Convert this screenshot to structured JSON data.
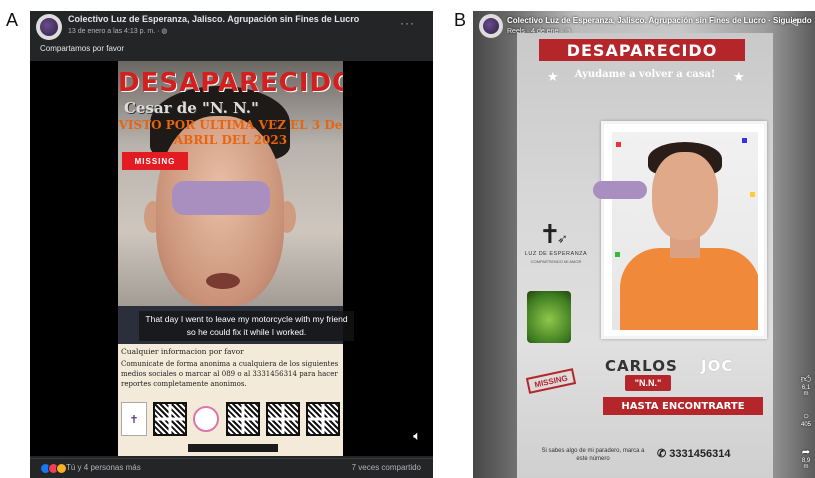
{
  "labels": {
    "a": "A",
    "b": "B"
  },
  "panel_a": {
    "page_name": "Colectivo Luz de Esperanza, Jalisco. Agrupación sin Fines de Lucro",
    "meta": "13 de enero a las 4:13 p. m. · ",
    "more": "···",
    "caption": "Compartamos por favor",
    "flyer": {
      "title": "DESAPARECIDO",
      "name_line": "Cesar de \"N. N.\"",
      "last_seen": "VISTO POR ULTIMA VEZ EL 3 De ABRIL DEL 2023",
      "missing": "MISSING",
      "info_head": "Cualquier informacion por favor",
      "info_body": "Comunicate de forma anonima a cualquiera de los siguientes medios sociales o marcar al 089 o al 3331456314 para hacer reportes completamente anonimos."
    },
    "subtitle": "That day I went to leave my motorcycle with my friend so he could fix it while I worked.",
    "volume_icon": "speaker-icon",
    "reactions_text": "Tú y 4 personas más",
    "shares": "7 veces compartido"
  },
  "panel_b": {
    "page_name": "Colectivo Luz de Esperanza, Jalisco. Agrupación sin Fines de Lucro · Siguiendo",
    "meta": "Reels · 4 de ene · ",
    "flyer": {
      "title": "DESAPARECIDO",
      "subtitle": "Ayudame a volver a casa!",
      "logo_text": "LUZ DE ESPERANZA",
      "logo_sub": "COMPARTIENDO MI AMOR",
      "name": "CARLOS",
      "name_ghost": "JOC",
      "nn": "\"N.N.\"",
      "missing": "MISSING",
      "hasta": "HASTA ENCONTRARTE",
      "phone_prompt": "Si sabes algo de mi paradero, marca a este número",
      "phone": "3331456314"
    },
    "side": {
      "likes": "6,1 m",
      "comments": "405",
      "shares": "8,9 m"
    }
  },
  "colors": {
    "missing_red": "#b5262b",
    "fb_dark": "#242526",
    "purple_blur": "#a88fc0"
  }
}
